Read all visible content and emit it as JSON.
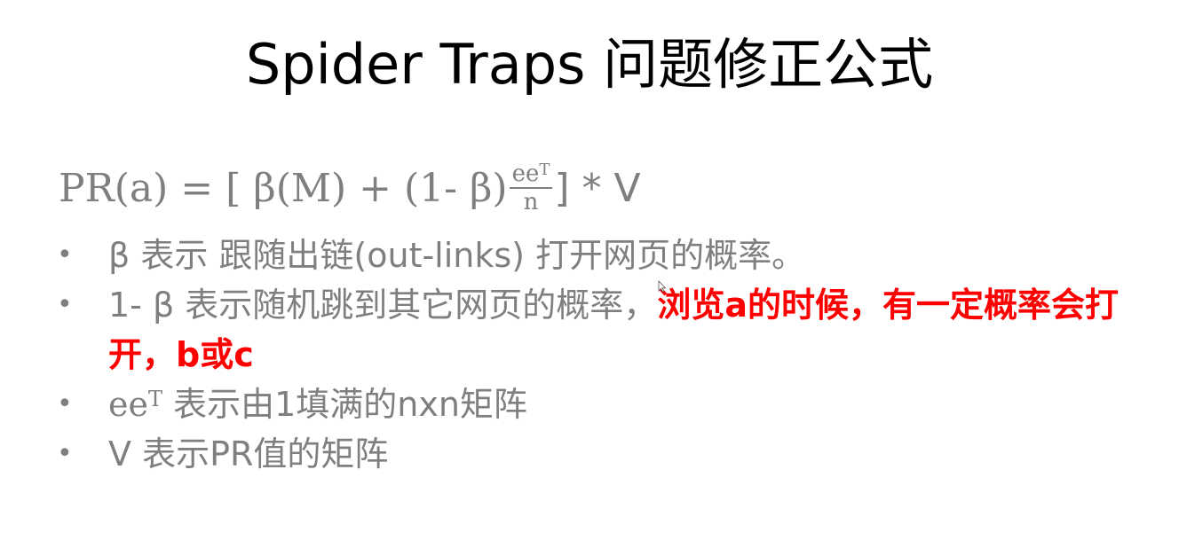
{
  "slide": {
    "title": "Spider Traps 问题修正公式",
    "formula": {
      "lhs": "PR(a) = [ β(M) +  (1- β)",
      "frac_num": "ee",
      "frac_num_sup": "T",
      "frac_den": "n",
      "rhs": " ] * V"
    },
    "bullets": [
      {
        "text": "β 表示 跟随出链(out-links) 打开网页的概率。"
      },
      {
        "text": "1- β 表示随机跳到其它网页的概率，",
        "highlight": "浏览a的时候，有一定概率会打开，b或c"
      },
      {
        "prefix": "ee",
        "prefix_sup": "T",
        "text": " 表示由1填满的nxn矩阵"
      },
      {
        "text": "V 表示PR值的矩阵"
      }
    ],
    "colors": {
      "title": "#000000",
      "body": "#7f7f7f",
      "highlight": "#ff0000"
    }
  }
}
